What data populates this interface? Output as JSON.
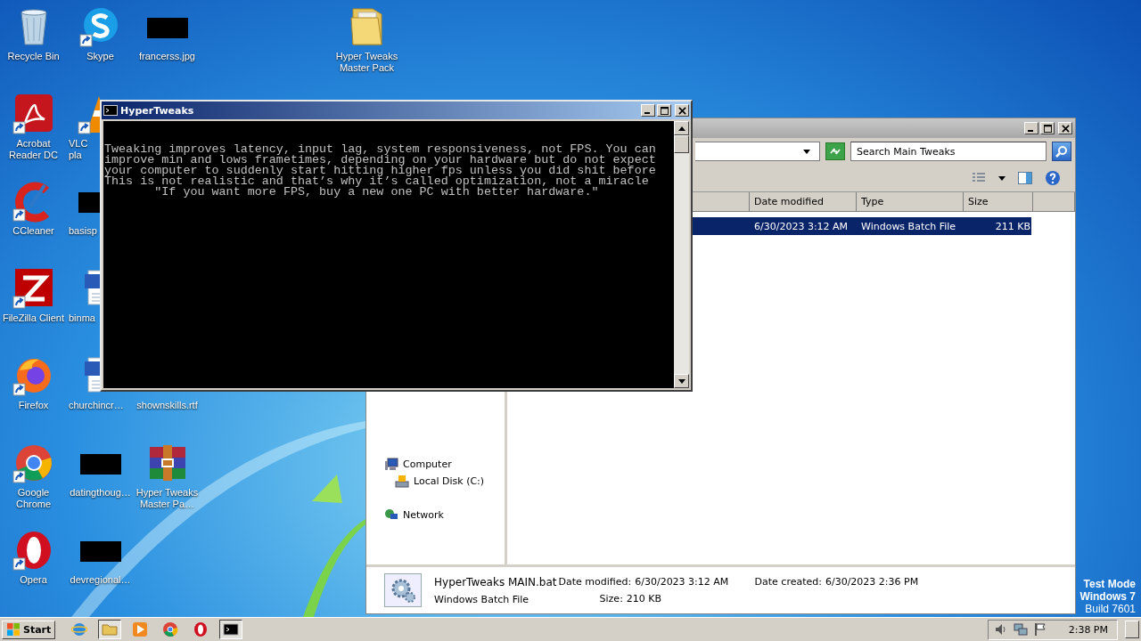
{
  "desktop": {
    "icon_rows": [
      [
        {
          "kind": "recycle",
          "lines": [
            "Recycle Bin"
          ],
          "shortcut": false,
          "clipped": false
        },
        {
          "kind": "skype",
          "lines": [
            "Skype"
          ],
          "shortcut": true,
          "clipped": false
        },
        {
          "kind": "redacted",
          "lines": [
            "francerss.jpg"
          ],
          "shortcut": false,
          "clipped": false
        }
      ],
      [
        {
          "kind": "acrobat",
          "lines": [
            "Acrobat",
            "Reader DC"
          ],
          "shortcut": true,
          "clipped": false
        },
        {
          "kind": "vlc",
          "lines": [
            "VLC",
            "pla"
          ],
          "shortcut": true,
          "clipped": true
        }
      ],
      [
        {
          "kind": "ccleaner",
          "lines": [
            "CCleaner"
          ],
          "shortcut": true,
          "clipped": false
        },
        {
          "kind": "redacted",
          "lines": [
            "basisp"
          ],
          "shortcut": false,
          "clipped": true
        }
      ],
      [
        {
          "kind": "filezilla",
          "lines": [
            "FileZilla Client"
          ],
          "shortcut": true,
          "clipped": false
        },
        {
          "kind": "word",
          "lines": [
            "binma"
          ],
          "shortcut": false,
          "clipped": true
        }
      ],
      [
        {
          "kind": "firefox",
          "lines": [
            "Firefox"
          ],
          "shortcut": true,
          "clipped": false
        },
        {
          "kind": "word",
          "lines": [
            "churchincr…"
          ],
          "shortcut": false,
          "clipped": true
        },
        {
          "kind": "hidden",
          "lines": [
            "shownskills.rtf"
          ]
        }
      ],
      [
        {
          "kind": "chrome",
          "lines": [
            "Google",
            "Chrome"
          ],
          "shortcut": true,
          "clipped": false
        },
        {
          "kind": "redacted",
          "lines": [
            "datingthoug…"
          ],
          "shortcut": false,
          "clipped": false
        },
        {
          "kind": "winrar",
          "lines": [
            "Hyper Tweaks",
            "Master Pa…"
          ],
          "shortcut": false,
          "clipped": false
        }
      ],
      [
        {
          "kind": "opera",
          "lines": [
            "Opera"
          ],
          "shortcut": true,
          "clipped": false
        },
        {
          "kind": "redacted",
          "lines": [
            "devregional…"
          ],
          "shortcut": false,
          "clipped": false
        }
      ]
    ],
    "folder": {
      "lines": [
        "Hyper Tweaks",
        "Master Pack"
      ]
    },
    "watermark_text": [
      "Test Mode",
      "Windows 7",
      "Build 7601"
    ]
  },
  "explorer": {
    "active": false,
    "search": {
      "placeholder": "Search Main Tweaks"
    },
    "columns": [
      "Date modified",
      "Type",
      "Size"
    ],
    "rows": [
      {
        "cells": [
          "6/30/2023 3:12 AM",
          "Windows Batch File",
          "211 KB"
        ],
        "selected": true
      }
    ],
    "nav": [
      {
        "label": "Computer",
        "kind": "computer",
        "children": [
          {
            "label": "Local Disk (C:)",
            "kind": "disk"
          }
        ]
      },
      {
        "label": "Network",
        "kind": "network"
      }
    ],
    "details": {
      "name": "HyperTweaks MAIN.bat",
      "type": "Windows Batch File",
      "fields": [
        {
          "label": "Date modified:",
          "value": "6/30/2023 3:12 AM"
        },
        {
          "label": "Size:",
          "value": "210 KB"
        },
        {
          "label": "Date created:",
          "value": "6/30/2023 2:36 PM"
        }
      ]
    }
  },
  "console": {
    "title": "HyperTweaks",
    "active": true,
    "lines": [
      "Tweaking improves latency, input lag, system responsiveness, not FPS. You can",
      "improve min and lows frametimes, depending on your hardware but do not expect",
      "your computer to suddenly start hitting higher fps unless you did shit before",
      "This is not realistic and that’s why it’s called optimization, not a miracle",
      "       \"If you want more FPS, buy a new one PC with better hardware.\""
    ]
  },
  "taskbar": {
    "start": "Start",
    "items": [
      {
        "kind": "ie",
        "active": false
      },
      {
        "kind": "explorer",
        "active": true
      },
      {
        "kind": "media",
        "active": false
      },
      {
        "kind": "chrome",
        "active": false
      },
      {
        "kind": "opera",
        "active": false
      },
      {
        "kind": "cmd",
        "active": true
      }
    ],
    "clock": "2:38 PM"
  }
}
